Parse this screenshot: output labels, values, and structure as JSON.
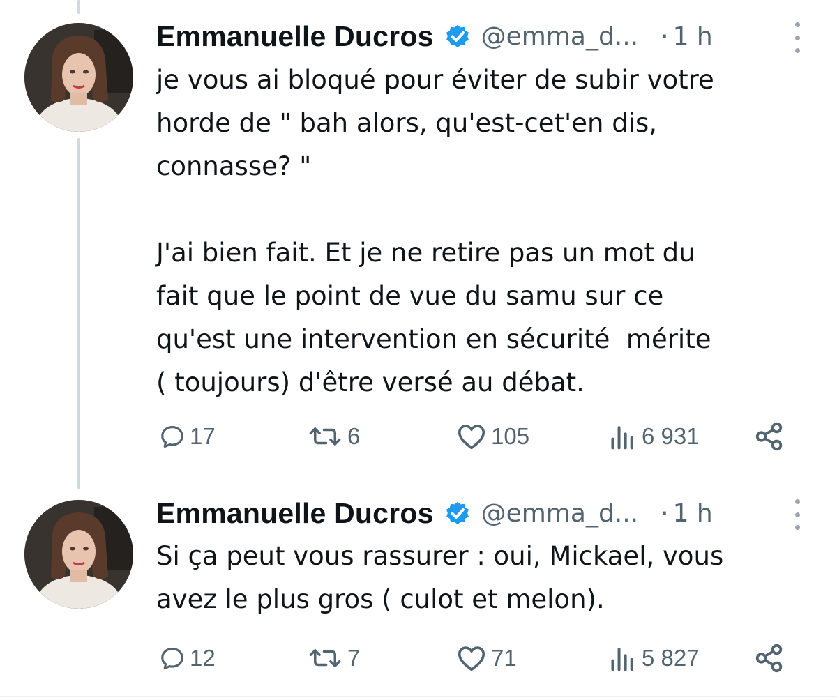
{
  "tweets": [
    {
      "author": {
        "name": "Emmanuelle Ducros",
        "handle": "@emma_d...",
        "verified": true
      },
      "separator": "·",
      "time": "1 h",
      "text": "je vous ai bloqué pour éviter de subir votre\nhorde de \" bah alors, qu'est-cet'en dis,\nconnasse? \"\n\nJ'ai bien fait. Et je ne retire pas un mot du\nfait que le point de vue du samu sur ce\nqu'est une intervention en sécurité  mérite\n( toujours) d'être versé au débat.",
      "stats": {
        "replies": "17",
        "reposts": "6",
        "likes": "105",
        "views": "6 931"
      }
    },
    {
      "author": {
        "name": "Emmanuelle Ducros",
        "handle": "@emma_d...",
        "verified": true
      },
      "separator": "·",
      "time": "1 h",
      "text": "Si ça peut vous rassurer : oui, Mickael, vous\navez le plus gros ( culot et melon).",
      "stats": {
        "replies": "12",
        "reposts": "7",
        "likes": "71",
        "views": "5 827"
      }
    }
  ],
  "icons": {
    "verified": "verified-badge-icon",
    "more": "more-options-icon",
    "reply": "reply-icon",
    "repost": "repost-icon",
    "like": "heart-icon",
    "views": "views-chart-icon",
    "share": "share-icon"
  },
  "colors": {
    "text": "#0f1419",
    "secondary": "#536471",
    "verified": "#1d9bf0",
    "thread_line": "#cfd9de"
  }
}
